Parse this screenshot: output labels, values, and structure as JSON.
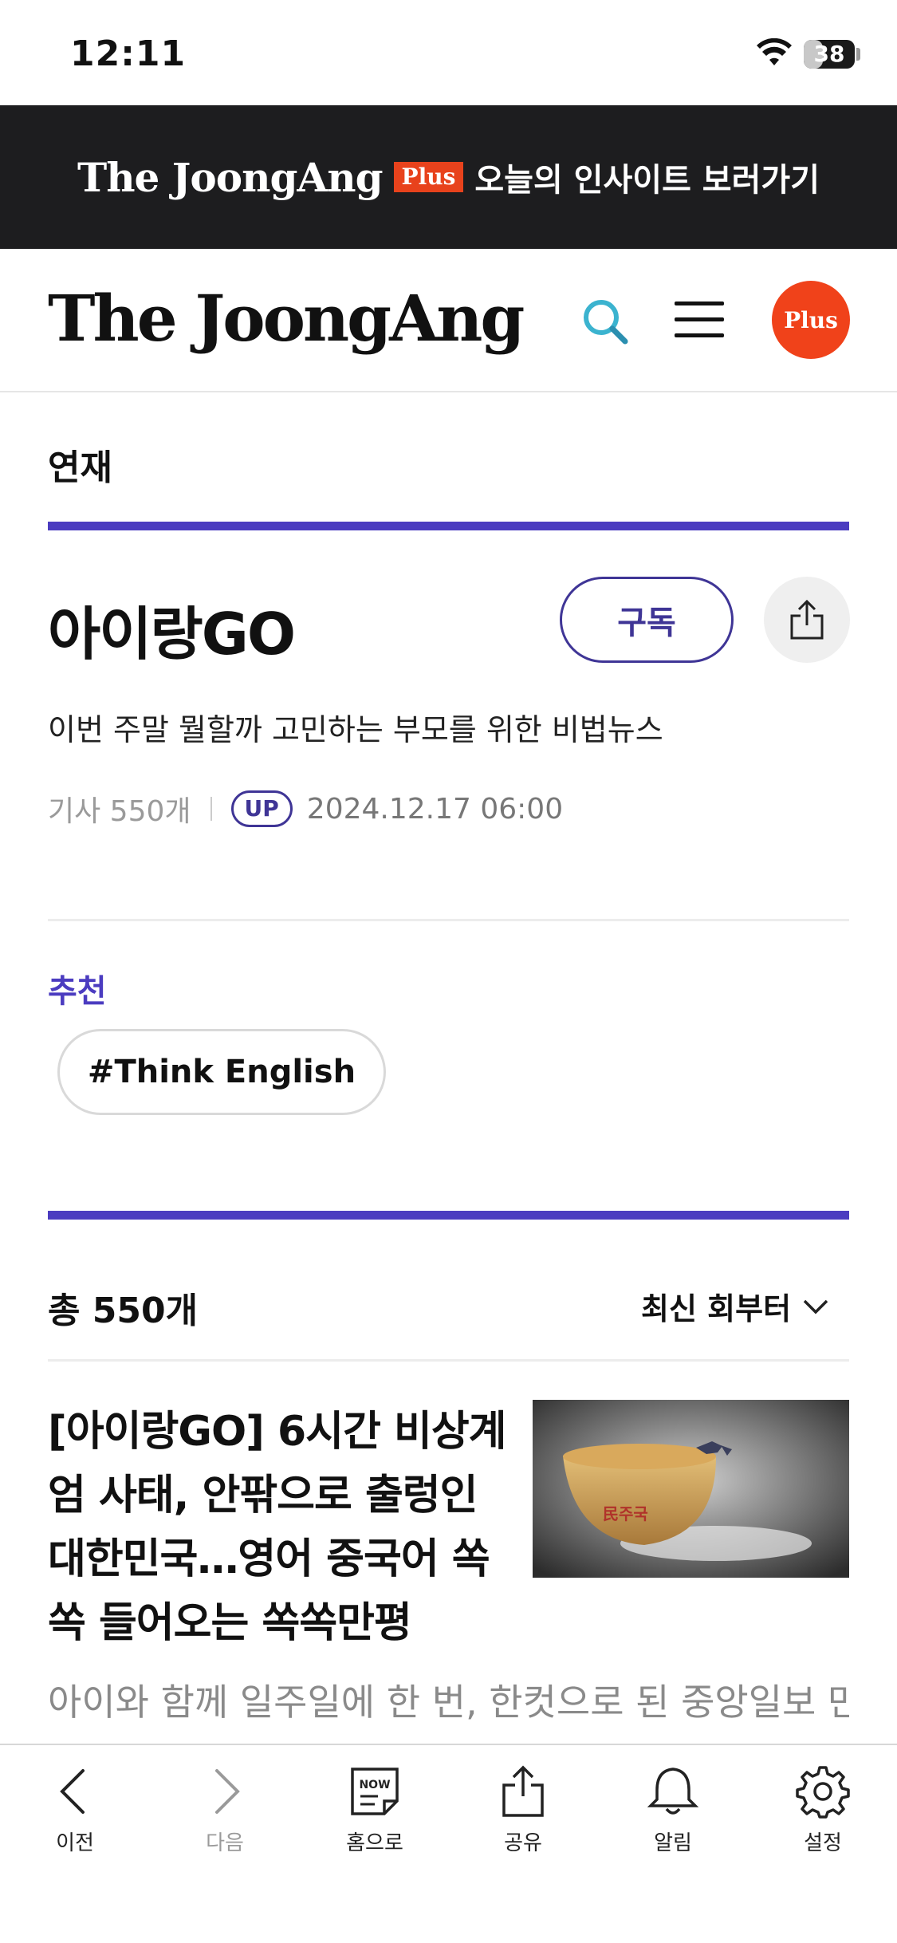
{
  "status_bar": {
    "time": "12:11",
    "battery": "38",
    "battery_level": 0.38
  },
  "promo": {
    "brand": "The JoongAng",
    "plus": "Plus",
    "text": "오늘의 인사이트 보러가기"
  },
  "header": {
    "logo": "The JoongAng",
    "plus_button": "Plus"
  },
  "section": {
    "label": "연재"
  },
  "series": {
    "title": "아이랑GO",
    "subscribe_label": "구독",
    "description": "이번 주말 뭘할까 고민하는 부모를 위한 비법뉴스",
    "article_count": "기사 550개",
    "up_badge": "UP",
    "updated": "2024.12.17 06:00"
  },
  "recommend": {
    "label": "추천",
    "tag": "#Think English"
  },
  "list": {
    "total": "총 550개",
    "sort_label": "최신 회부터"
  },
  "article": {
    "title": "[아이랑GO] 6시간 비상계엄 사태, 안팎으로 출렁인 대한민국…영어 중국어 쏙쏙 들어오는 쏙쏙만평",
    "title_lines": [
      "[아이랑GO] 6시간 비상계",
      "엄 사태, 안팎으로 출렁인",
      "대한민국…영어 중국어 쏙",
      "쏙 들어오는 쏙쏙만평"
    ],
    "summary": "아이와 함께 일주일에 한 번, 한컷으로 된 중앙일보 만",
    "thumb_text": "民주국"
  },
  "toolbar": {
    "items": [
      {
        "label": "이전",
        "icon": "chevron-left-icon"
      },
      {
        "label": "다음",
        "icon": "chevron-right-icon"
      },
      {
        "label": "홈으로",
        "icon": "now-home-icon",
        "icon_text": "NOW"
      },
      {
        "label": "공유",
        "icon": "share-icon"
      },
      {
        "label": "알림",
        "icon": "bell-icon"
      },
      {
        "label": "설정",
        "icon": "gear-icon"
      }
    ]
  },
  "colors": {
    "accent": "#4b3cc0",
    "plus_red": "#f0421a",
    "banner_bg": "#1d1d1f",
    "search_teal": "#3bb3cf"
  }
}
